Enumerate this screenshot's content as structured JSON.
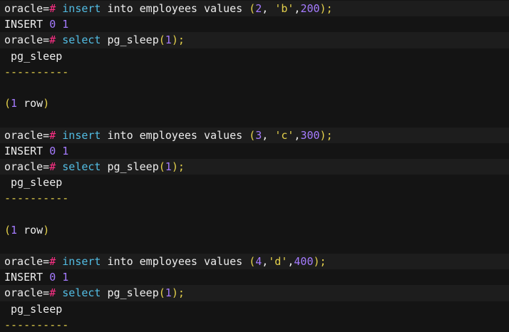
{
  "terminal": {
    "prompt": "oracle=",
    "hash": "#",
    "blocks": [
      {
        "insert_kw": "insert",
        "insert_text": " into employees values ",
        "open_paren": "(",
        "id": "2",
        "sep1": ", ",
        "str": "'b'",
        "sep2": ",",
        "amount": "200",
        "close_paren": ")",
        "semi": ";",
        "result_word": "INSERT ",
        "result_a": "0",
        "result_b": " 1",
        "select_kw": "select",
        "select_fn": " pg_sleep",
        "select_open": "(",
        "select_arg": "1",
        "select_close": ")",
        "select_semi": ";",
        "column_header": " pg_sleep",
        "dashes": "----------",
        "row_open": "(",
        "row_num": "1",
        "row_text": " row",
        "row_close": ")"
      },
      {
        "insert_kw": "insert",
        "insert_text": " into employees values ",
        "open_paren": "(",
        "id": "3",
        "sep1": ", ",
        "str": "'c'",
        "sep2": ",",
        "amount": "300",
        "close_paren": ")",
        "semi": ";",
        "result_word": "INSERT ",
        "result_a": "0",
        "result_b": " 1",
        "select_kw": "select",
        "select_fn": " pg_sleep",
        "select_open": "(",
        "select_arg": "1",
        "select_close": ")",
        "select_semi": ";",
        "column_header": " pg_sleep",
        "dashes": "----------",
        "row_open": "(",
        "row_num": "1",
        "row_text": " row",
        "row_close": ")"
      },
      {
        "insert_kw": "insert",
        "insert_text": " into employees values ",
        "open_paren": "(",
        "id": "4",
        "sep1": ",",
        "str": "'d'",
        "sep2": ",",
        "amount": "400",
        "close_paren": ")",
        "semi": ";",
        "result_word": "INSERT ",
        "result_a": "0",
        "result_b": " 1",
        "select_kw": "select",
        "select_fn": " pg_sleep",
        "select_open": "(",
        "select_arg": "1",
        "select_close": ")",
        "select_semi": ";",
        "column_header": " pg_sleep",
        "dashes": "----------"
      }
    ]
  }
}
